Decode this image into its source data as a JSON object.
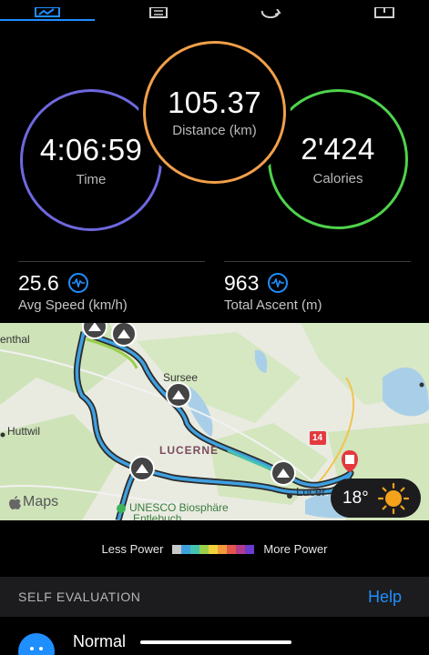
{
  "tabs": [
    {
      "icon": "chart-icon",
      "selected": true
    },
    {
      "icon": "list-icon",
      "selected": false
    },
    {
      "icon": "refresh-icon",
      "selected": false
    },
    {
      "icon": "calendar-icon",
      "selected": false
    }
  ],
  "rings": {
    "time": {
      "value": "4:06:59",
      "label": "Time",
      "color": "#6e68e0"
    },
    "distance": {
      "value": "105.37",
      "label": "Distance (km)",
      "color": "#f1a04a"
    },
    "calories": {
      "value": "2'424",
      "label": "Calories",
      "color": "#4ed34c"
    }
  },
  "stats": {
    "avg_speed": {
      "value": "25.6",
      "label": "Avg Speed (km/h)"
    },
    "total_ascent": {
      "value": "963",
      "label": "Total Ascent (m)"
    }
  },
  "map": {
    "labels": {
      "enthal": "enthal",
      "sursee": "Sursee",
      "huttwil": "Huttwil",
      "lucerne_region": "LUCERNE",
      "unesco": "UNESCO Biosphäre",
      "entlebuch": "Entlebuch",
      "lucern_city": "Lucer",
      "road_number": "14"
    },
    "maps_brand": "Maps",
    "weather": {
      "temp": "18°",
      "icon": "sun-icon"
    }
  },
  "legend": {
    "less": "Less Power",
    "more": "More Power",
    "colors": [
      "#c8c8c8",
      "#3fa0e0",
      "#45c3b0",
      "#9ad04a",
      "#f2d23c",
      "#f39a3a",
      "#e2574a",
      "#b33b8c",
      "#6a3bcf"
    ]
  },
  "self_evaluation": {
    "title": "SELF EVALUATION",
    "help": "Help"
  },
  "feel": {
    "label": "Normal"
  },
  "accent": "#1f8fff"
}
